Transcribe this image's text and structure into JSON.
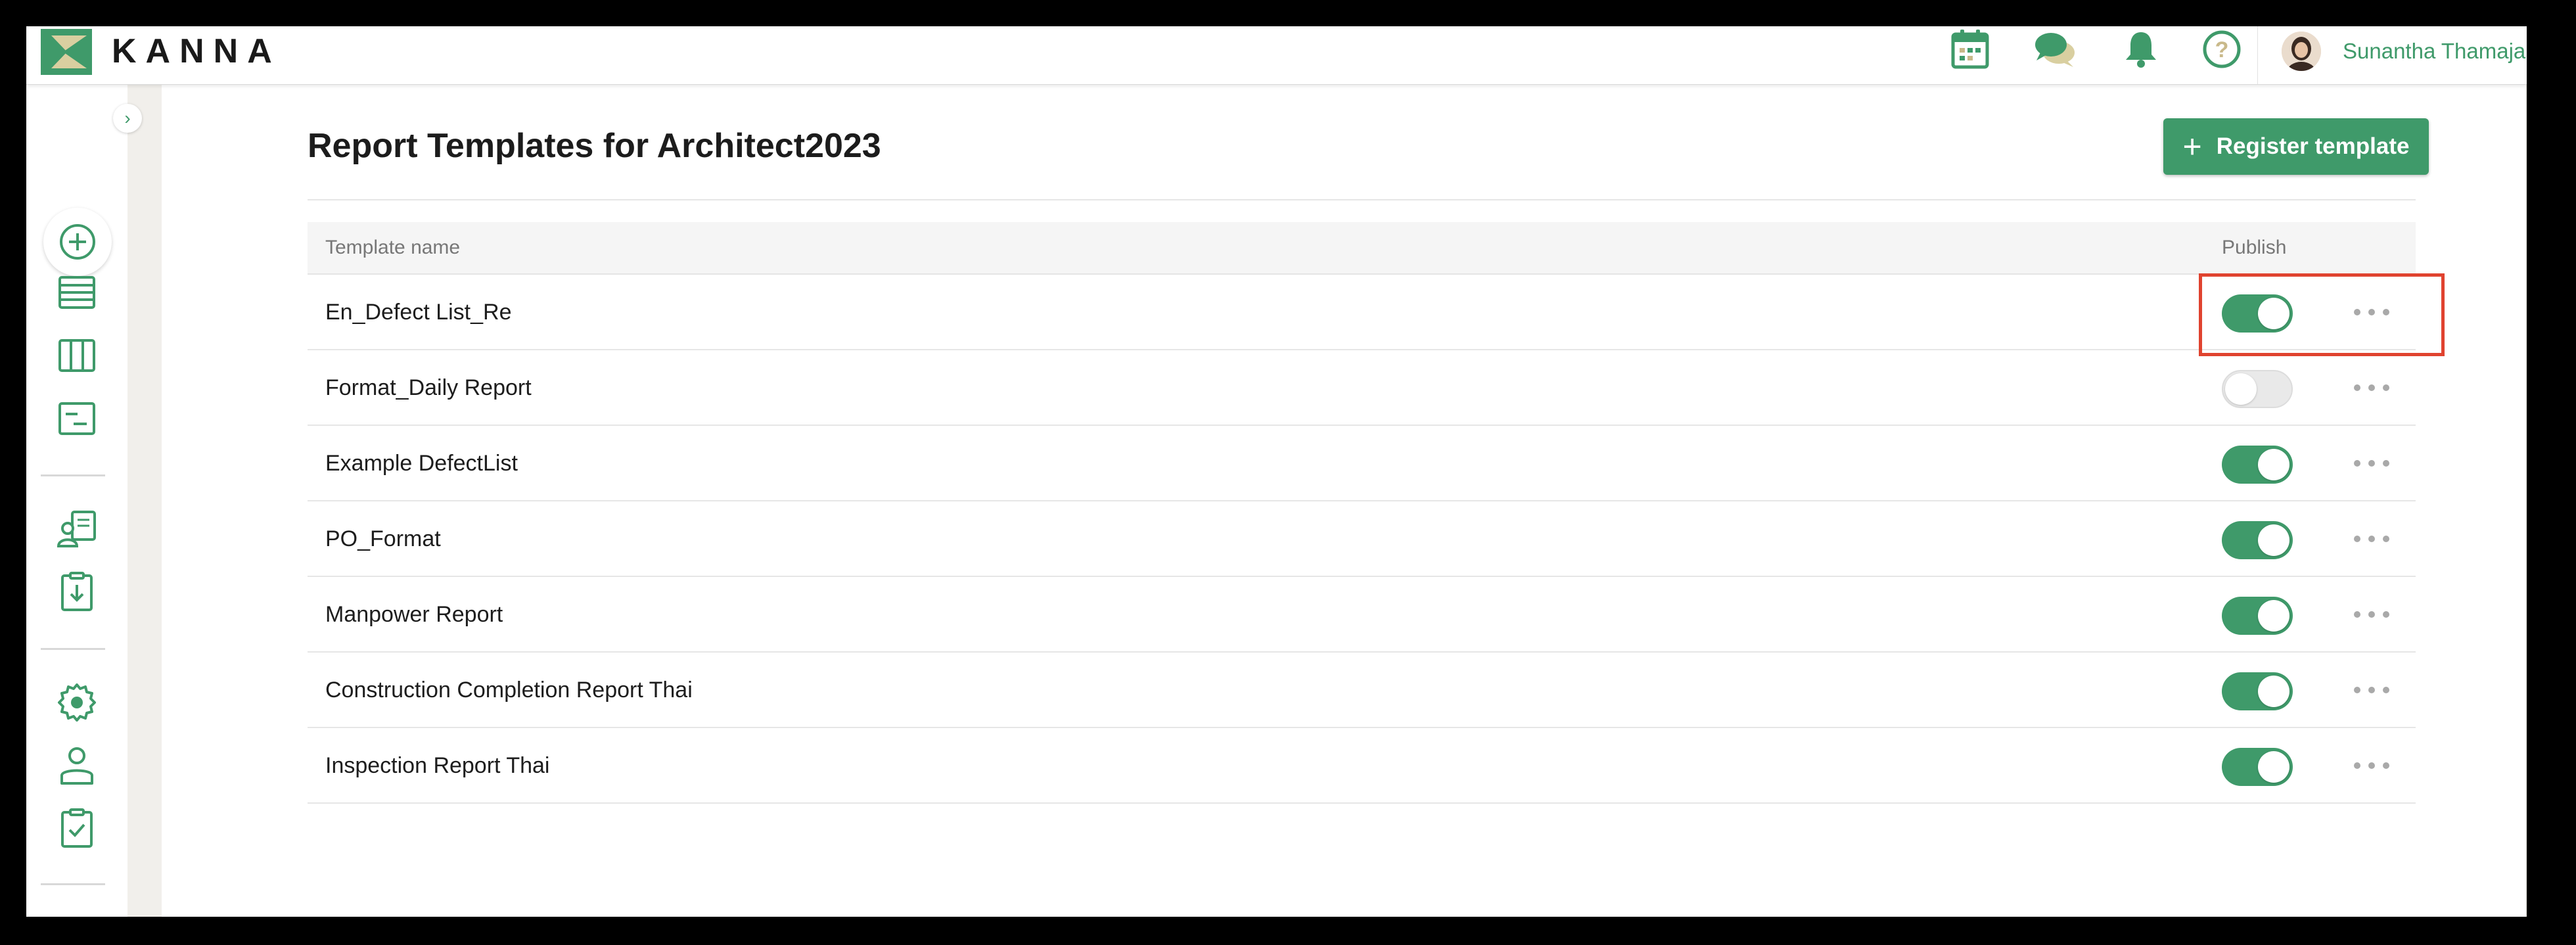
{
  "app": {
    "logo_text": "KANNA",
    "user_name": "Sunantha Thamajak"
  },
  "topbar": {
    "icons": [
      "calendar-icon",
      "chat-icon",
      "bell-icon",
      "help-icon"
    ]
  },
  "sidebar": {
    "expand_glyph": "›",
    "items": [
      "add-icon",
      "list-view-icon",
      "board-view-icon",
      "gantt-view-icon",
      "contacts-icon",
      "download-icon",
      "settings-icon",
      "user-icon",
      "checklist-icon"
    ]
  },
  "page": {
    "title": "Report Templates for Architect2023",
    "register_button": {
      "plus": "+",
      "label": "Register template"
    }
  },
  "table": {
    "columns": {
      "name": "Template name",
      "publish": "Publish"
    },
    "rows": [
      {
        "name": "En_Defect List_Re",
        "published": true
      },
      {
        "name": "Format_Daily Report",
        "published": false
      },
      {
        "name": "Example DefectList",
        "published": true
      },
      {
        "name": "PO_Format",
        "published": true
      },
      {
        "name": "Manpower Report",
        "published": true
      },
      {
        "name": "Construction Completion Report Thai",
        "published": true
      },
      {
        "name": "Inspection Report Thai",
        "published": true
      }
    ]
  },
  "colors": {
    "accent": "#3f9a6a",
    "highlight": "#e0432f"
  }
}
